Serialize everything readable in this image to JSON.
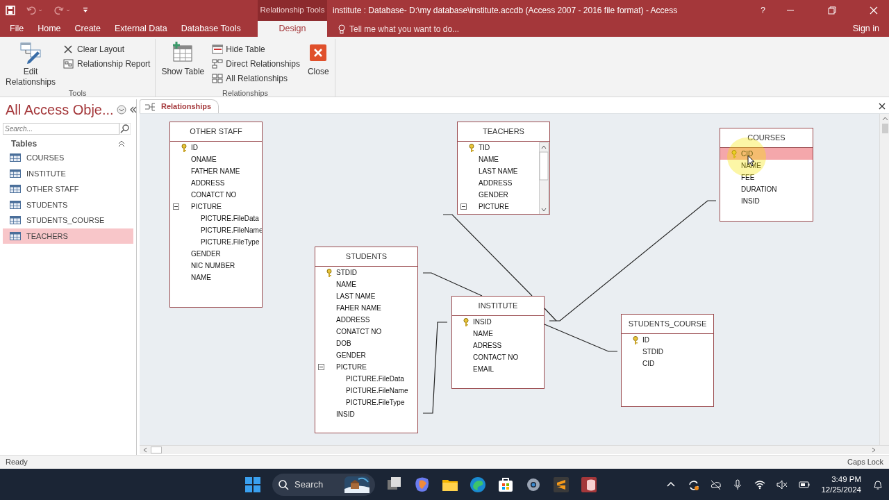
{
  "title_bar": {
    "context_label": "Relationship Tools",
    "title": "institute : Database- D:\\my database\\institute.accdb (Access 2007 - 2016 file format) - Access",
    "help": "?"
  },
  "ribbon_tabs": [
    {
      "label": "File",
      "selected": false
    },
    {
      "label": "Home",
      "selected": false
    },
    {
      "label": "Create",
      "selected": false
    },
    {
      "label": "External Data",
      "selected": false
    },
    {
      "label": "Database Tools",
      "selected": false
    },
    {
      "label": "Design",
      "selected": true
    }
  ],
  "tell_me": {
    "placeholder": "Tell me what you want to do..."
  },
  "sign_in": "Sign in",
  "ribbon_groups": [
    {
      "label": "Tools",
      "commands": [
        {
          "label": "Edit Relationships",
          "kind": "large"
        },
        {
          "label": "Clear Layout",
          "kind": "small"
        },
        {
          "label": "Relationship Report",
          "kind": "small"
        }
      ]
    },
    {
      "label": "Relationships",
      "commands": [
        {
          "label": "Show Table",
          "kind": "large"
        },
        {
          "label": "Hide Table",
          "kind": "small"
        },
        {
          "label": "Direct Relationships",
          "kind": "small"
        },
        {
          "label": "All Relationships",
          "kind": "small"
        },
        {
          "label": "Close",
          "kind": "large"
        }
      ]
    }
  ],
  "nav_pane": {
    "title": "All Access Obje...",
    "search": {
      "placeholder": "Search..."
    },
    "group": "Tables",
    "items": [
      {
        "label": "COURSES",
        "selected": false
      },
      {
        "label": "INSTITUTE",
        "selected": false
      },
      {
        "label": "OTHER STAFF",
        "selected": false
      },
      {
        "label": "STUDENTS",
        "selected": false
      },
      {
        "label": "STUDENTS_COURSE",
        "selected": false
      },
      {
        "label": "TEACHERS",
        "selected": true
      }
    ]
  },
  "document_tab": {
    "label": "Relationships",
    "selected": true
  },
  "tables": [
    {
      "name": "OTHER STAFF",
      "fields": [
        {
          "label": "ID",
          "key": true,
          "selected": false
        },
        {
          "label": "ONAME",
          "selected": false
        },
        {
          "label": "FATHER NAME",
          "selected": false
        },
        {
          "label": "ADDRESS",
          "selected": false
        },
        {
          "label": "CONATCT NO",
          "selected": false
        },
        {
          "label": "PICTURE",
          "selected": false,
          "expanded": true,
          "children": [
            {
              "label": "PICTURE.FileData",
              "selected": false
            },
            {
              "label": "PICTURE.FileName",
              "selected": false
            },
            {
              "label": "PICTURE.FileType",
              "selected": false
            }
          ]
        },
        {
          "label": "GENDER",
          "selected": false
        },
        {
          "label": "NIC NUMBER",
          "selected": false
        },
        {
          "label": "NAME",
          "selected": false
        }
      ]
    },
    {
      "name": "TEACHERS",
      "scrollable": true,
      "fields": [
        {
          "label": "TID",
          "key": true,
          "selected": false
        },
        {
          "label": "NAME",
          "selected": false
        },
        {
          "label": "LAST NAME",
          "selected": false
        },
        {
          "label": "ADDRESS",
          "selected": false
        },
        {
          "label": "GENDER",
          "selected": false
        },
        {
          "label": "PICTURE",
          "selected": false,
          "expanded": true
        }
      ]
    },
    {
      "name": "COURSES",
      "fields": [
        {
          "label": "CID",
          "key": true,
          "selected": true
        },
        {
          "label": "NAME",
          "selected": false
        },
        {
          "label": "FEE",
          "selected": false
        },
        {
          "label": "DURATION",
          "selected": false
        },
        {
          "label": "INSID",
          "selected": false
        }
      ]
    },
    {
      "name": "STUDENTS",
      "fields": [
        {
          "label": "STDID",
          "key": true,
          "selected": false
        },
        {
          "label": "NAME",
          "selected": false
        },
        {
          "label": "LAST NAME",
          "selected": false
        },
        {
          "label": "FAHER NAME",
          "selected": false
        },
        {
          "label": "ADDRESS",
          "selected": false
        },
        {
          "label": "CONATCT NO",
          "selected": false
        },
        {
          "label": "DOB",
          "selected": false
        },
        {
          "label": "GENDER",
          "selected": false
        },
        {
          "label": "PICTURE",
          "selected": false,
          "expanded": true,
          "children": [
            {
              "label": "PICTURE.FileData",
              "selected": false
            },
            {
              "label": "PICTURE.FileName",
              "selected": false
            },
            {
              "label": "PICTURE.FileType",
              "selected": false
            }
          ]
        },
        {
          "label": "INSID",
          "selected": false
        }
      ]
    },
    {
      "name": "INSTITUTE",
      "fields": [
        {
          "label": "INSID",
          "key": true,
          "selected": false
        },
        {
          "label": "NAME",
          "selected": false
        },
        {
          "label": "ADRESS",
          "selected": false
        },
        {
          "label": "CONTACT NO",
          "selected": false
        },
        {
          "label": "EMAIL",
          "selected": false
        }
      ]
    },
    {
      "name": "STUDENTS_COURSE",
      "fields": [
        {
          "label": "ID",
          "key": true,
          "selected": false
        },
        {
          "label": "STDID",
          "selected": false
        },
        {
          "label": "CID",
          "selected": false
        }
      ]
    }
  ],
  "status_bar": {
    "left": "Ready",
    "right": "Caps Lock"
  },
  "taskbar": {
    "search": {
      "placeholder": "Search"
    },
    "time": "3:49 PM",
    "date": "12/25/2024"
  }
}
